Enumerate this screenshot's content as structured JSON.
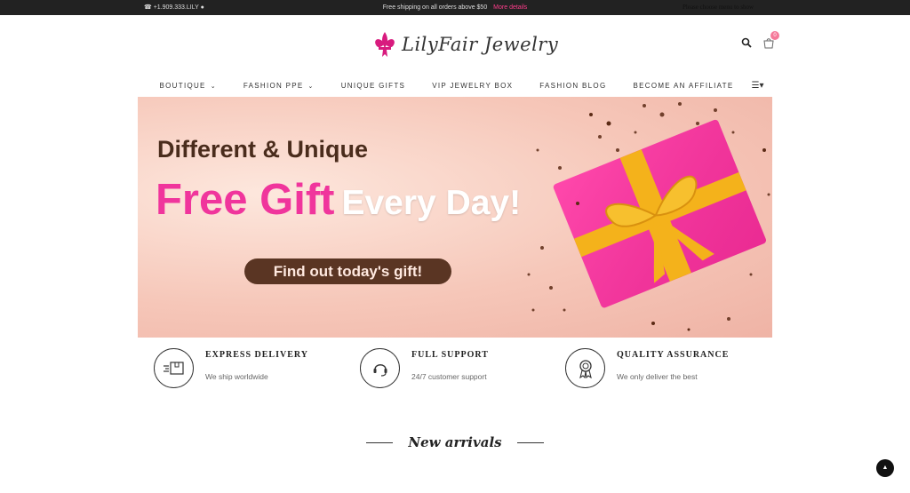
{
  "topbar": {
    "phone": "+1.909.333.LILY",
    "shipping": "Free shipping on all orders above $50",
    "more_details": "More details",
    "menu_note": "Please choose menu to show"
  },
  "brand": {
    "name": "LilyFair Jewelry"
  },
  "cart": {
    "count": "0"
  },
  "nav": {
    "items": [
      {
        "label": "BOUTIQUE"
      },
      {
        "label": "FASHION PPE"
      },
      {
        "label": "UNIQUE GIFTS"
      },
      {
        "label": "VIP JEWELRY BOX"
      },
      {
        "label": "FASHION BLOG"
      },
      {
        "label": "BECOME AN AFFILIATE"
      }
    ]
  },
  "hero": {
    "line1": "Different & Unique",
    "line2_pink": "Free Gift",
    "line2_white": "Every Day!",
    "cta": "Find out today's gift!"
  },
  "features": [
    {
      "title": "EXPRESS DELIVERY",
      "subtitle": "We ship worldwide",
      "icon": "truck-box-icon"
    },
    {
      "title": "FULL SUPPORT",
      "subtitle": "24/7 customer support",
      "icon": "headset-icon"
    },
    {
      "title": "QUALITY ASSURANCE",
      "subtitle": "We only deliver the best",
      "icon": "award-medal-icon"
    }
  ],
  "arrivals": {
    "title": "New arrivals"
  },
  "colors": {
    "accent_pink": "#f0359c",
    "topbar": "#222222",
    "cta_brown": "#5a3523"
  }
}
